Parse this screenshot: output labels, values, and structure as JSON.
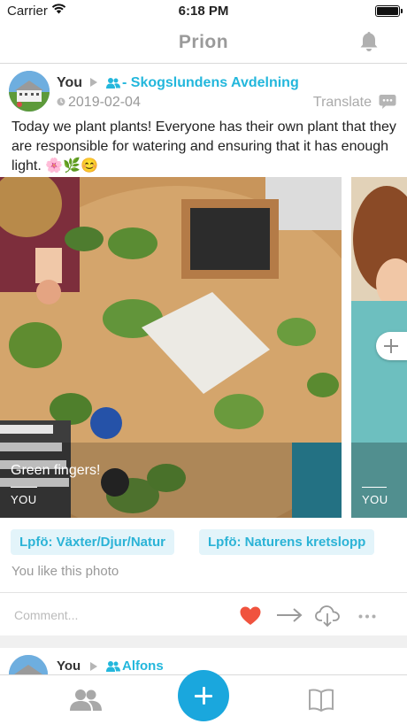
{
  "status_bar": {
    "carrier": "Carrier",
    "time": "6:18 PM"
  },
  "nav": {
    "title": "Prion"
  },
  "post": {
    "author": "You",
    "group": "- Skogslundens Avdelning",
    "date": "2019-02-04",
    "translate_label": "Translate",
    "text": "Today we plant plants! Everyone has their own plant that they are responsible for watering and ensuring that it has enough light. 🌸🌿😊",
    "photos": [
      {
        "caption": "Green fingers!",
        "author": "YOU"
      },
      {
        "caption": "",
        "author": "YOU"
      }
    ],
    "tags": [
      "Lpfö: Växter/Djur/Natur",
      "Lpfö: Naturens kretslopp"
    ],
    "likes_text": "You like this photo",
    "comment_placeholder": "Comment..."
  },
  "next_post": {
    "author": "You",
    "group": "Alfons"
  },
  "colors": {
    "accent": "#23b7dc",
    "heart": "#f0533e",
    "tab_add": "#1aa7dd"
  },
  "tab_bar": {
    "icons": [
      "people-icon",
      "add-icon",
      "book-icon"
    ]
  }
}
